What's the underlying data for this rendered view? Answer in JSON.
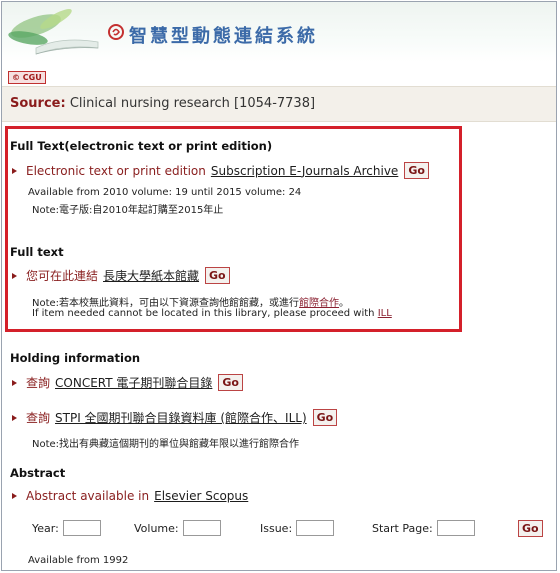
{
  "header": {
    "system_title": "智慧型動態連結系統",
    "badge": "CGU"
  },
  "source": {
    "label": "Source:",
    "title": "Clinical nursing research [1054-7738]"
  },
  "full_text_section": {
    "heading": "Full Text(electronic text or print edition)",
    "item_text": "Electronic text or print edition",
    "link": "Subscription E-Journals Archive",
    "go": "Go",
    "availability": "Available from 2010 volume: 19 until 2015 volume: 24",
    "note": "Note:電子版:自2010年起訂購至2015年止"
  },
  "full_text_2": {
    "heading": "Full text",
    "item_text": "您可在此連結",
    "link": "長庚大學紙本館藏",
    "go": "Go",
    "note_prefix": "Note:若本校無此資料，可由以下資源查詢他館館藏，或進行",
    "note_link": "館際合作",
    "note_suffix": "。",
    "note_en_prefix": "If item needed cannot be located in this library, please proceed with",
    "note_en_link": "ILL"
  },
  "holding": {
    "heading": "Holding information",
    "item1_text": "查詢",
    "item1_link": "CONCERT 電子期刊聯合目錄",
    "item1_go": "Go",
    "item2_text": "查詢",
    "item2_link": "STPI 全國期刊聯合目錄資料庫 (館際合作、ILL)",
    "item2_go": "Go",
    "note": "Note:找出有典藏這個期刊的單位與館藏年限以進行館際合作"
  },
  "abstract": {
    "heading": "Abstract",
    "item_text": "Abstract available in",
    "link": "Elsevier Scopus",
    "year_label": "Year:",
    "volume_label": "Volume:",
    "issue_label": "Issue:",
    "start_page_label": "Start Page:",
    "go": "Go",
    "availability": "Available from 1992"
  }
}
